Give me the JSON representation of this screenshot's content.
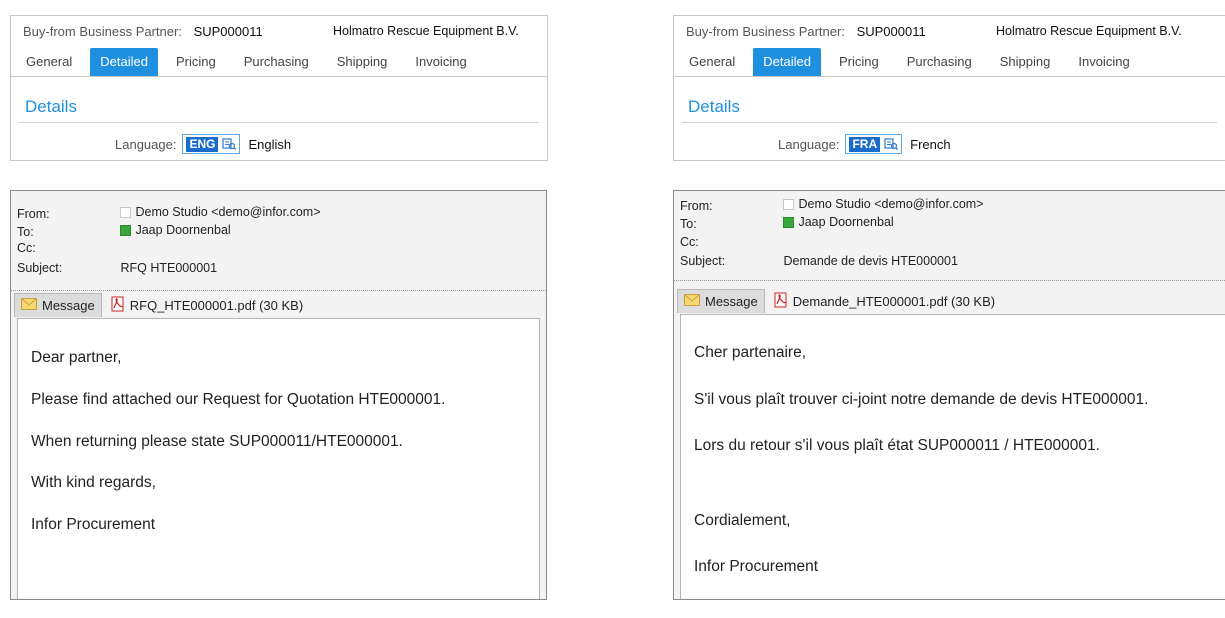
{
  "business_partner": {
    "label": "Buy-from Business Partner:",
    "code": "SUP000011",
    "name": "Holmatro Rescue Equipment B.V.",
    "tabs": [
      "General",
      "Detailed",
      "Pricing",
      "Purchasing",
      "Shipping",
      "Invoicing"
    ],
    "active_tab": "Detailed",
    "section_title": "Details",
    "language_label": "Language:"
  },
  "left": {
    "language_code": "ENG",
    "language_name": "English",
    "mail": {
      "from_label": "From:",
      "from": "Demo Studio <demo@infor.com>",
      "to_label": "To:",
      "to": "Jaap Doornenbal",
      "cc_label": "Cc:",
      "subject_label": "Subject:",
      "subject": "RFQ HTE000001",
      "message_tab": "Message",
      "attachment": "RFQ_HTE000001.pdf (30 KB)",
      "body": [
        "Dear partner,",
        "Please find attached our Request for Quotation HTE000001.",
        "When returning please state SUP000011/HTE000001.",
        "With kind regards,",
        "Infor Procurement"
      ]
    }
  },
  "right": {
    "language_code": "FRA",
    "language_name": "French",
    "mail": {
      "from_label": "From:",
      "from": "Demo Studio <demo@infor.com>",
      "to_label": "To:",
      "to": "Jaap Doornenbal",
      "cc_label": "Cc:",
      "subject_label": "Subject:",
      "subject": "Demande de devis HTE000001",
      "message_tab": "Message",
      "attachment": "Demande_HTE000001.pdf (30 KB)",
      "body": [
        "Cher partenaire,",
        "S'il vous plaît trouver ci-joint notre demande de devis HTE000001.",
        "Lors du retour s'il vous plaît état SUP000011 / HTE000001.",
        "Cordialement,",
        "Infor Procurement"
      ]
    }
  },
  "colors": {
    "accent": "#1f8fe0",
    "language_code_bg": "#1a6ccc"
  },
  "icons": {
    "lookup": "lookup-icon",
    "envelope": "envelope-icon",
    "pdf": "pdf-icon",
    "recipient": "recipient-check-icon"
  }
}
